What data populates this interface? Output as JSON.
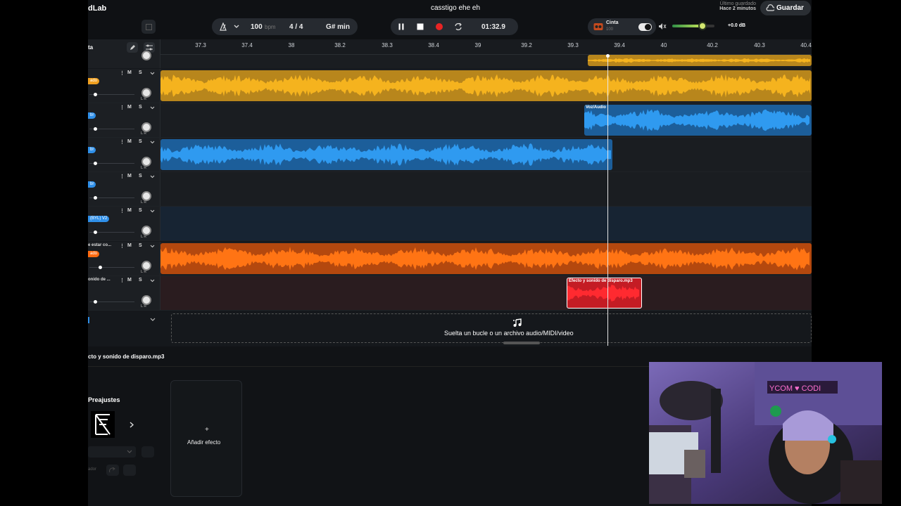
{
  "app": {
    "logo": "dLab",
    "project_title": "casstigo ehe eh",
    "last_saved_label": "Último guardado",
    "last_saved_time": "Hace 2 minutos",
    "save_label": "Guardar"
  },
  "transport": {
    "tempo_value": "100",
    "tempo_unit": "bpm",
    "time_signature": "4 / 4",
    "key": "G# min",
    "time": "01:32.9"
  },
  "tape": {
    "label": "Cinta",
    "value": "100"
  },
  "master": {
    "volume_db": "+0.0 dB",
    "volume_level": 0.72
  },
  "ruler": {
    "ticks": [
      "37.3",
      "37.4",
      "38",
      "38.2",
      "38.3",
      "38.4",
      "39",
      "39.2",
      "39.3",
      "39.4",
      "40",
      "40.2",
      "40.3",
      "40.4"
    ]
  },
  "tracks_header": {
    "label": "ta"
  },
  "tracks": [
    {
      "name": "",
      "badge": "ado",
      "badge_color": "#f0a020",
      "mute": "M",
      "solo": "S"
    },
    {
      "name": "",
      "badge": "br",
      "badge_color": "#2f8fe8",
      "mute": "M",
      "solo": "S"
    },
    {
      "name": "",
      "badge": "br",
      "badge_color": "#2f8fe8",
      "mute": "M",
      "solo": "S"
    },
    {
      "name": "",
      "badge": "br",
      "badge_color": "#2f8fe8",
      "mute": "M",
      "solo": "S"
    },
    {
      "name": "",
      "badge": "(BYL) V2",
      "badge_color": "#2f8fe8",
      "mute": "M",
      "solo": "S"
    },
    {
      "name": "e estar co...",
      "badge": "ado",
      "badge_color": "#ff6a10",
      "mute": "M",
      "solo": "S"
    },
    {
      "name": "onido de ...",
      "badge": "",
      "badge_color": "#e0202a",
      "mute": "M",
      "solo": "S"
    }
  ],
  "clips": {
    "voz_audio": "Voz/Audio",
    "shot_effect": "Efecto y sonido de disparo.mp3"
  },
  "dropzone": {
    "text": "Suelta un bucle o un archivo audio/MIDI/video"
  },
  "bottom_panel": {
    "title": "cto y sonido de disparo.mp3",
    "presets_label": "Preajustes",
    "add_effect_label": "Añadir efecto",
    "add_effect_plus": "+",
    "small_label": "ador"
  },
  "colors": {
    "yellow": "#e8a61c",
    "blue": "#2f8fe8",
    "orange": "#ff6a10",
    "red": "#e0202a",
    "accent_green": "#7fe06a"
  }
}
